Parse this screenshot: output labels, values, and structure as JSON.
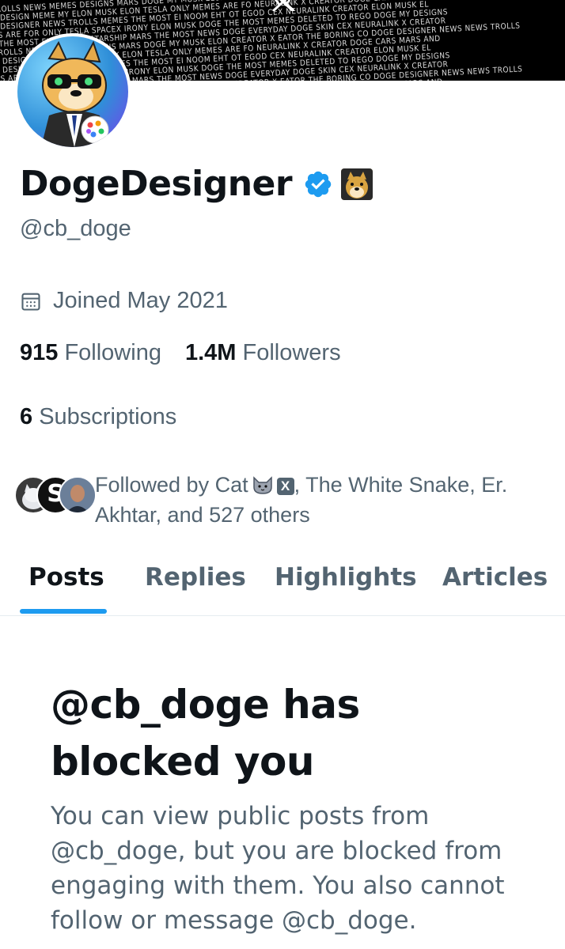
{
  "banner": {
    "rows": [
      "ALS TROLLS NEWS MEMES DESIGNS MARS DOGE MY MUSK ELON CREATOR X EATOR THE BORING CO DOGE DESIGNER NEWS NEWS TROLLS",
      "NEWS DESIGN MEME MY ELON MUSK ELON TESLA ONLY MEMES ARE FO NEURALINK X CREATOR DOGE CARS MARS AND",
      "DOGE DESIGNER NEWS TROLLS MEMES THE MOST EI NOOM EHT OT EGOD CEX NEURALINK CREATOR ELON MUSK EL",
      "MEMES ARE FOR ONLY TESLA SPACEX IRONY ELON MUSK DOGE THE MOST MEMES DELETED TO REGO DOGE MY DESIGNS",
      "ROFT THE MOST ELON MUSK STARSHIP MARS THE MOST NEWS DOGE EVERYDAY DOGE SKIN CEX NEURALINK X CREATOR"
    ]
  },
  "profile": {
    "display_name": "DogeDesigner",
    "handle": "@cb_doge",
    "joined": "Joined May 2021",
    "following_count": "915",
    "following_label": "Following",
    "followers_count": "1.4M",
    "followers_label": "Followers",
    "subscriptions_count": "6",
    "subscriptions_label": "Subscriptions",
    "followed_by_prefix": "Followed by Cat",
    "followed_by_badge": "X",
    "followed_by_rest": ", The White Snake, Er. Akhtar, and 527 others",
    "mutual_face_letter": "S"
  },
  "tabs": [
    {
      "label": "Posts"
    },
    {
      "label": "Replies"
    },
    {
      "label": "Highlights"
    },
    {
      "label": "Articles"
    }
  ],
  "blocked": {
    "title": "@cb_doge has blocked you",
    "body": "You can view public posts from @cb_doge, but you are blocked from engaging with them. You also cannot follow or message @cb_doge."
  },
  "colors": {
    "accent": "#1d9bf0",
    "text_primary": "#0f1419",
    "text_secondary": "#536471",
    "verified": "#1d9bf0"
  },
  "icons": {
    "verified": "verified-badge-icon",
    "calendar": "calendar-icon",
    "x_logo": "x-logo-icon"
  }
}
